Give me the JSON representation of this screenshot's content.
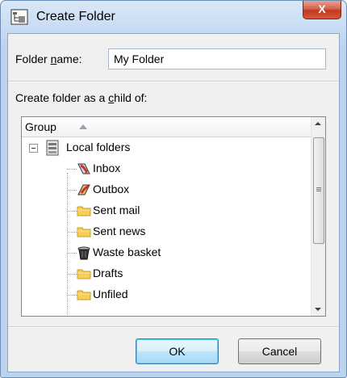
{
  "window": {
    "title": "Create Folder",
    "close_label": "X"
  },
  "form": {
    "folder_name_label_pre": "Folder ",
    "folder_name_label_key": "n",
    "folder_name_label_post": "ame:",
    "folder_name_value": "My Folder",
    "child_label_pre": "Create folder as a ",
    "child_label_key": "c",
    "child_label_post": "hild of:"
  },
  "tree": {
    "column_header": "Group",
    "root": {
      "label": "Local folders",
      "icon": "server-icon",
      "expanded": true
    },
    "items": [
      {
        "label": "Inbox",
        "icon": "inbox-icon"
      },
      {
        "label": "Outbox",
        "icon": "outbox-icon"
      },
      {
        "label": "Sent mail",
        "icon": "folder-icon"
      },
      {
        "label": "Sent news",
        "icon": "folder-icon"
      },
      {
        "label": "Waste basket",
        "icon": "trash-icon"
      },
      {
        "label": "Drafts",
        "icon": "folder-icon"
      },
      {
        "label": "Unfiled",
        "icon": "folder-icon"
      }
    ]
  },
  "buttons": {
    "ok_label": "OK",
    "cancel_label": "Cancel"
  },
  "colors": {
    "close_button": "#c2371f",
    "folder_yellow": "#f5cf5a",
    "ok_button_border": "#3c7fb1"
  }
}
